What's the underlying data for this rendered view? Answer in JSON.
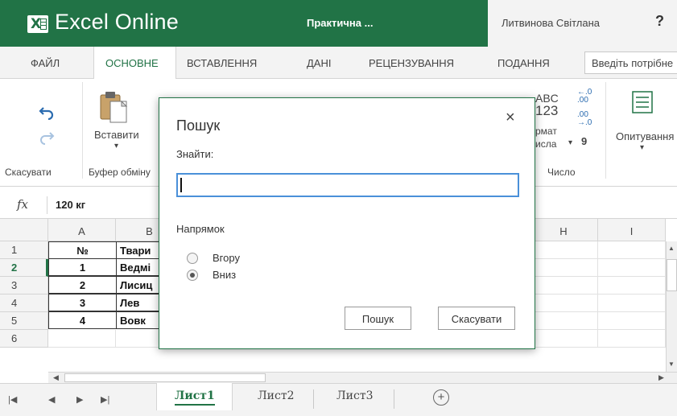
{
  "titlebar": {
    "app_name": "Excel Online",
    "doc_title": "Практична ...",
    "user_name": "Литвинова Світлана",
    "help": "?"
  },
  "ribbon_tabs": [
    "ФАЙЛ",
    "ОСНОВНЕ",
    "ВСТАВЛЕННЯ",
    "ДАНІ",
    "РЕЦЕНЗУВАННЯ",
    "ПОДАННЯ"
  ],
  "active_tab": "ОСНОВНЕ",
  "tell_me_placeholder": "Введіть потрібне",
  "ribbon": {
    "paste_label": "Вставити",
    "undo_group": "Скасувати",
    "clipboard_group": "Буфер обміну",
    "number_format_label": "Формат числа",
    "number_format_line1": "рмат",
    "number_format_line2": "исла",
    "number_group": "Число",
    "abc_line1": "ABC",
    "abc_line2": "123",
    "survey_label": "Опитування",
    "inc_decimal": "←.0 .00",
    "dec_decimal": ".00 →.0",
    "comma": "9"
  },
  "formula_bar": {
    "fx": "fx",
    "value": "120 кг"
  },
  "grid": {
    "columns": [
      "A",
      "B",
      "H",
      "I"
    ],
    "rows": [
      "1",
      "2",
      "3",
      "4",
      "5",
      "6"
    ],
    "col_a": [
      "№",
      "1",
      "2",
      "3",
      "4",
      ""
    ],
    "col_b": [
      "Твари",
      "Ведмі",
      "Лисиц",
      "Лев",
      "Вовк",
      ""
    ]
  },
  "sheets": [
    "Лист1",
    "Лист2",
    "Лист3"
  ],
  "active_sheet": "Лист1",
  "dialog": {
    "title": "Пошук",
    "close": "×",
    "find_label": "Знайти:",
    "find_value": "",
    "direction_label": "Напрямок",
    "option_up": "Вгору",
    "option_down": "Вниз",
    "selected_option": "Вниз",
    "search_button": "Пошук",
    "cancel_button": "Скасувати"
  },
  "colors": {
    "brand": "#217346",
    "focus": "#4a90d9"
  }
}
